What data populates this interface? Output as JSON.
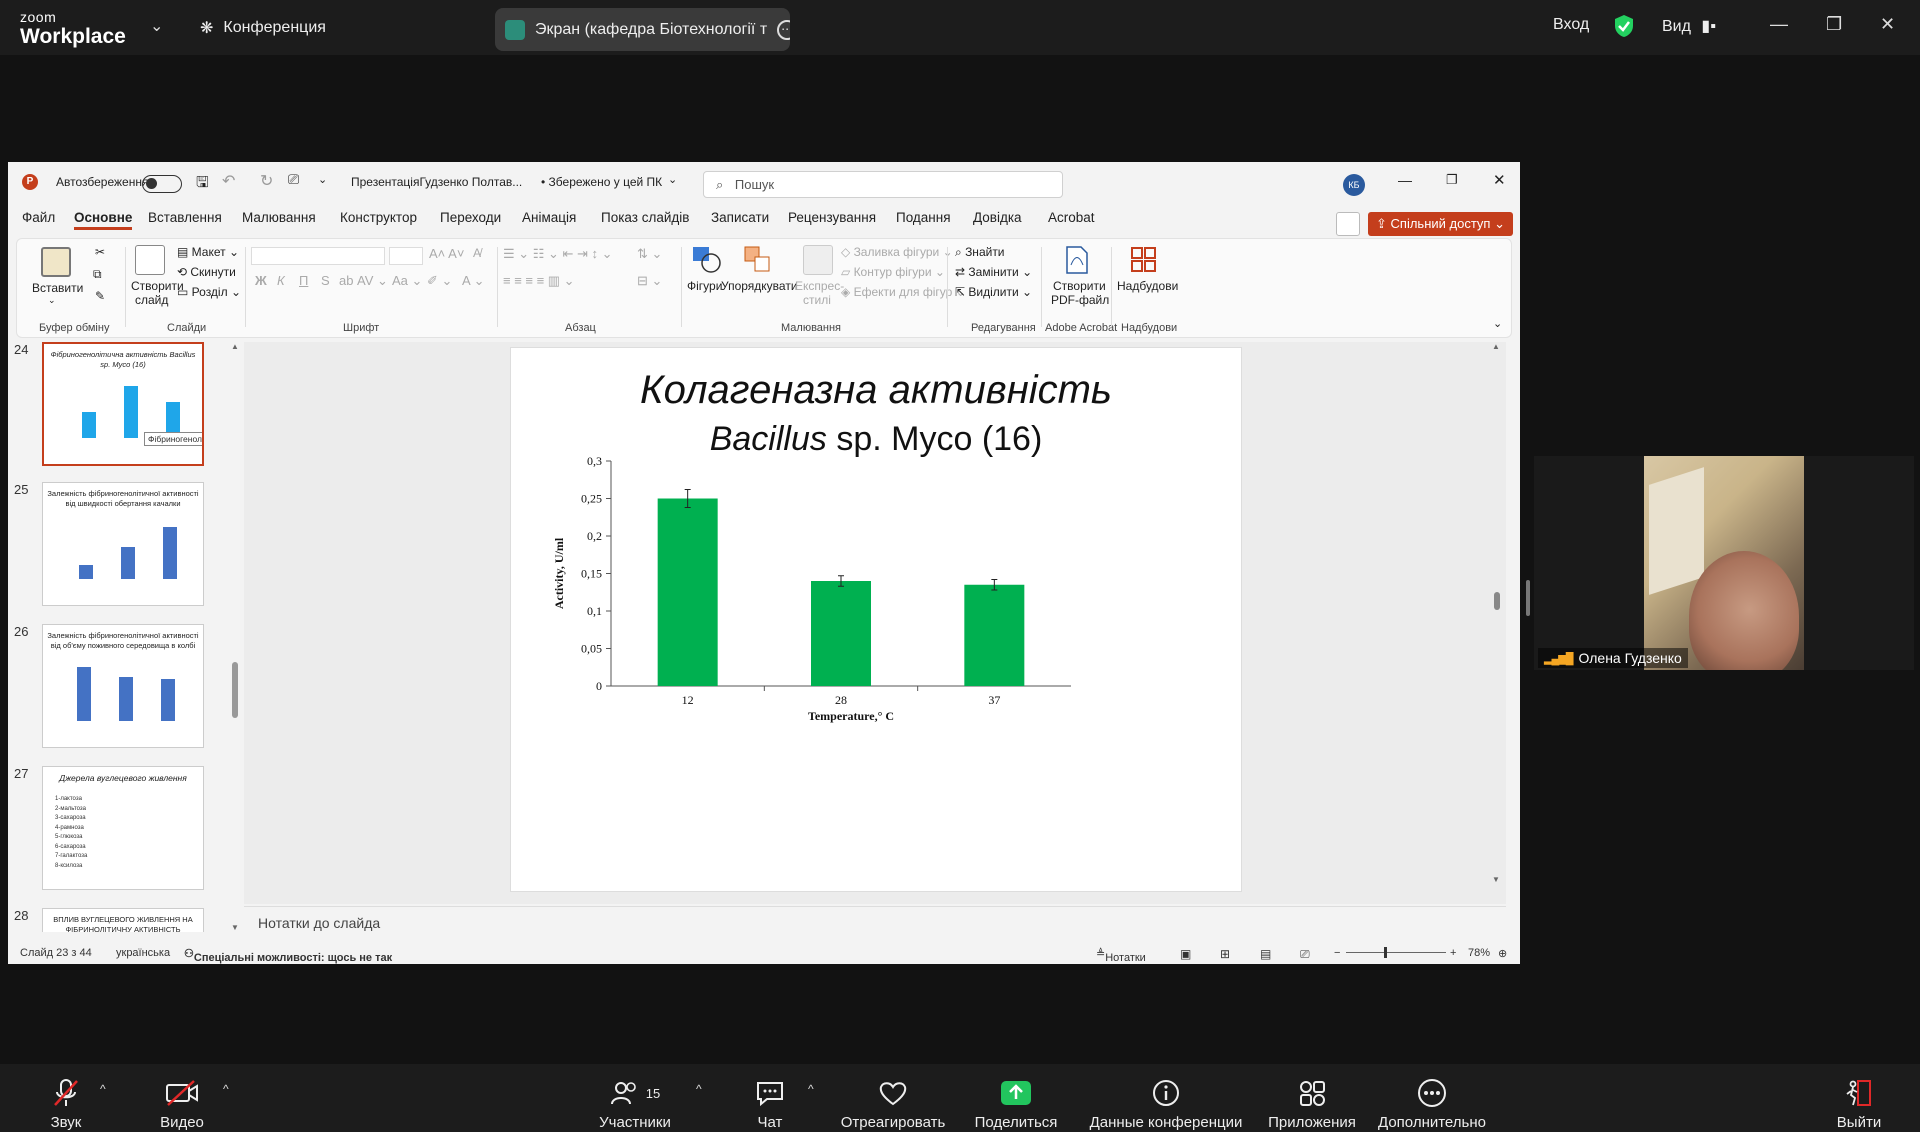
{
  "zoom": {
    "logo_small": "zoom",
    "logo_big": "Workplace",
    "conference_label": "Конференция",
    "screen_share_label": "Экран (кафедра Біотехнології т",
    "signin": "Вход",
    "view": "Вид",
    "participants_count": "15",
    "bottom": {
      "audio": "Звук",
      "video": "Видео",
      "participants": "Участники",
      "chat": "Чат",
      "react": "Отреагировать",
      "share": "Поделиться",
      "info": "Данные конференции",
      "apps": "Приложения",
      "more": "Дополнительно",
      "leave": "Выйти"
    }
  },
  "ppt": {
    "autosave": "Автозбереження",
    "filename": "ПрезентаціяГудзенко Полтав...",
    "saved": "• Збережено у цей ПК",
    "search_placeholder": "Пошук",
    "avatar": "КБ",
    "share_button": "Спільний доступ",
    "tabs": [
      "Файл",
      "Основне",
      "Вставлення",
      "Малювання",
      "Конструктор",
      "Переходи",
      "Анімація",
      "Показ слайдів",
      "Записати",
      "Рецензування",
      "Подання",
      "Довідка",
      "Acrobat"
    ],
    "ribbon": {
      "paste": "Вставити",
      "clipboard": "Буфер обміну",
      "new_slide": "Створити",
      "new_slide2": "слайд",
      "layout": "Макет",
      "reset": "Скинути",
      "section": "Розділ",
      "slides": "Слайди",
      "font": "Шрифт",
      "paragraph": "Абзац",
      "shapes": "Фігури",
      "arrange": "Упорядкувати",
      "quick_styles": "Експрес-",
      "quick_styles2": "стилі",
      "shape_fill": "Заливка фігури",
      "shape_outline": "Контур фігури",
      "shape_effects": "Ефекти для фігур",
      "drawing": "Малювання",
      "find": "Знайти",
      "replace": "Замінити",
      "select": "Виділити",
      "editing": "Редагування",
      "create_pdf": "Створити",
      "create_pdf2": "PDF-файл",
      "adobe": "Adobe Acrobat",
      "addins": "Надбудови",
      "addins_group": "Надбудови"
    },
    "thumbnails": [
      {
        "num": "24",
        "title": "Фібриногенолітична активність Bacillus sp. Myco (16)"
      },
      {
        "num": "25",
        "title": "Залежність фібриногенолітичної активності від швидкості обертання качалки"
      },
      {
        "num": "26",
        "title": "Залежність фібриногенолітичної активності від об'єму поживного середовища в колбі"
      },
      {
        "num": "27",
        "title": "Джерела вуглецевого живлення"
      },
      {
        "num": "28",
        "title": "ВПЛИВ ВУГЛЕЦЕВОГО ЖИВЛЕННЯ НА ФІБРИНОЛІТИЧНУ АКТИВНІСТЬ"
      }
    ],
    "thumb27_items": [
      "1-лактоза",
      "2-мальтоза",
      "3-сахароза",
      "4-рамноза",
      "5-глюкоза",
      "6-сахароза",
      "7-галактоза",
      "8-ксилоза"
    ],
    "tooltip": "Фібриногенолітична активність ...",
    "slide": {
      "title": "Колагеназна активність",
      "subtitle_italic": "Bacillus",
      "subtitle_rest": " sp. Myco (16)"
    },
    "notes": "Нотатки до слайда",
    "status": {
      "slide": "Слайд 23 з 44",
      "lang": "українська",
      "accessibility": "Спеціальні можливості: щось не так",
      "notes_btn": "Нотатки",
      "zoom": "78%"
    }
  },
  "video": {
    "name": "Олена Гудзенко"
  },
  "chart_data": {
    "type": "bar",
    "categories": [
      "12",
      "28",
      "37"
    ],
    "values": [
      0.25,
      0.14,
      0.135
    ],
    "errors": [
      0.012,
      0.007,
      0.007
    ],
    "xlabel": "Temperature,° C",
    "ylabel": "Activity, U/ml",
    "ylim": [
      0,
      0.3
    ],
    "yticks": [
      "0",
      "0,05",
      "0,1",
      "0,15",
      "0,2",
      "0,25",
      "0,3"
    ],
    "bar_color": "#00b050",
    "grid": false
  }
}
